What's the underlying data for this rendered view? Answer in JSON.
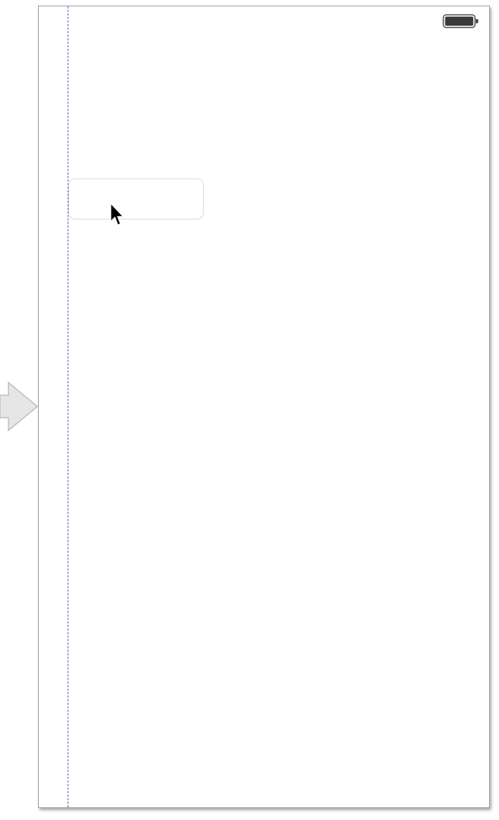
{
  "scene": {
    "background_color": "#ffffff",
    "border_color": "#9b9b9b"
  },
  "entry_point": {
    "icon": "initial-view-controller-arrow-icon",
    "color": "#e6e6e6"
  },
  "status_bar": {
    "battery_icon": "battery-full-icon"
  },
  "layout_guide": {
    "color": "#3b56c8",
    "style": "dashed"
  },
  "text_field": {
    "value": "",
    "placeholder": ""
  },
  "pointer": {
    "icon": "mouse-pointer-icon"
  }
}
